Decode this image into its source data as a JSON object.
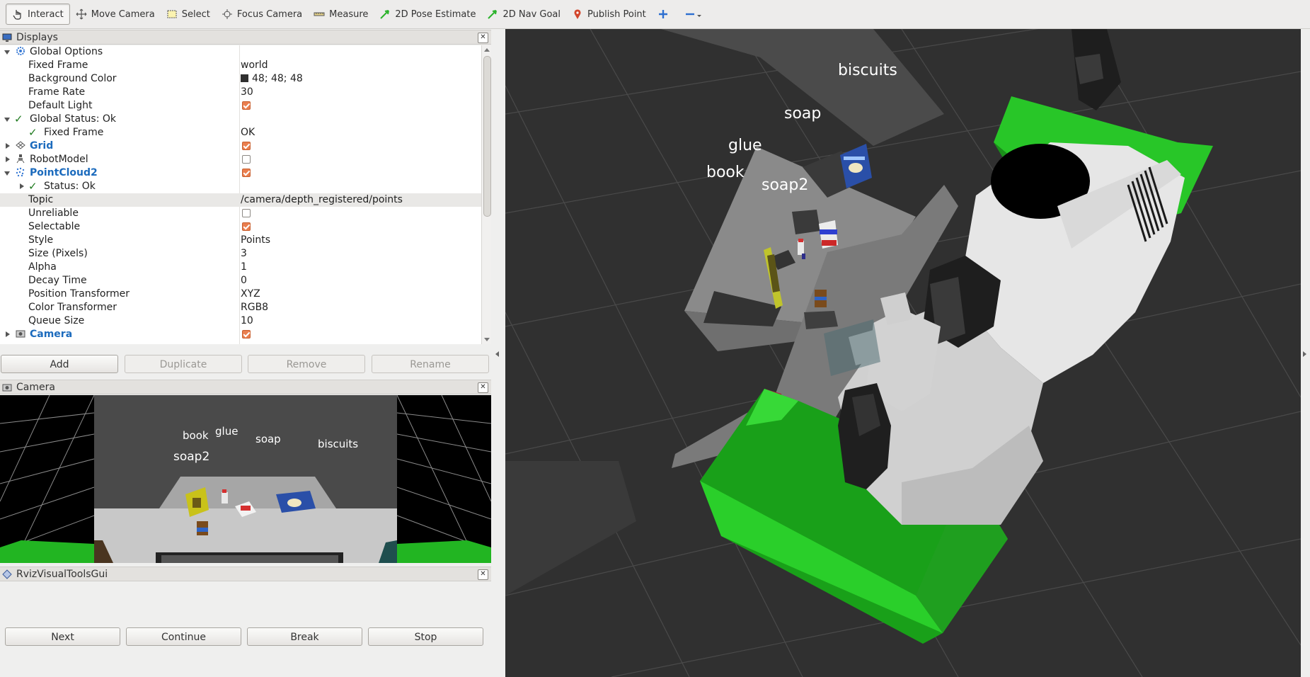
{
  "toolbar": {
    "tools": [
      {
        "label": "Interact",
        "icon": "hand-pointer-icon",
        "active": true
      },
      {
        "label": "Move Camera",
        "icon": "move-camera-icon"
      },
      {
        "label": "Select",
        "icon": "select-box-icon"
      },
      {
        "label": "Focus Camera",
        "icon": "focus-crosshair-icon"
      },
      {
        "label": "Measure",
        "icon": "ruler-icon"
      },
      {
        "label": "2D Pose Estimate",
        "icon": "green-arrow-icon"
      },
      {
        "label": "2D Nav Goal",
        "icon": "green-arrow-icon"
      },
      {
        "label": "Publish Point",
        "icon": "map-pin-icon"
      }
    ],
    "add_tool_icon": "plus-icon",
    "remove_tool_icon": "minus-icon"
  },
  "displays_panel": {
    "title": "Displays",
    "rows": [
      {
        "name": "Global Options"
      },
      {
        "name": "Fixed Frame",
        "value": "world"
      },
      {
        "name": "Background Color",
        "value": "48; 48; 48"
      },
      {
        "name": "Frame Rate",
        "value": "30"
      },
      {
        "name": "Default Light",
        "value": ""
      },
      {
        "name": "Global Status: Ok"
      },
      {
        "name": "Fixed Frame",
        "value": "OK"
      },
      {
        "name": "Grid"
      },
      {
        "name": "RobotModel"
      },
      {
        "name": "PointCloud2"
      },
      {
        "name": "Status: Ok"
      },
      {
        "name": "Topic",
        "value": "/camera/depth_registered/points"
      },
      {
        "name": "Unreliable"
      },
      {
        "name": "Selectable"
      },
      {
        "name": "Style",
        "value": "Points"
      },
      {
        "name": "Size (Pixels)",
        "value": "3"
      },
      {
        "name": "Alpha",
        "value": "1"
      },
      {
        "name": "Decay Time",
        "value": "0"
      },
      {
        "name": "Position Transformer",
        "value": "XYZ"
      },
      {
        "name": "Color Transformer",
        "value": "RGB8"
      },
      {
        "name": "Queue Size",
        "value": "10"
      },
      {
        "name": "Camera"
      }
    ],
    "checkbox_states": {
      "default_light": true,
      "grid": true,
      "robot_model": false,
      "pointcloud2": true,
      "unreliable": false,
      "selectable": true,
      "camera": true
    },
    "background_color_hex": "#303030",
    "buttons": {
      "add": "Add",
      "duplicate": "Duplicate",
      "remove": "Remove",
      "rename": "Rename"
    }
  },
  "camera_panel": {
    "title": "Camera",
    "labels": {
      "book": "book",
      "glue": "glue",
      "soap": "soap",
      "biscuits": "biscuits",
      "soap2": "soap2"
    }
  },
  "rviz_visual_tools_panel": {
    "title": "RvizVisualToolsGui",
    "buttons": {
      "next": "Next",
      "continue": "Continue",
      "break": "Break",
      "stop": "Stop"
    }
  },
  "view3d": {
    "background_hex": "#303030",
    "labels": {
      "biscuits": "biscuits",
      "soap": "soap",
      "glue": "glue",
      "book": "book",
      "soap2": "soap2"
    }
  },
  "colors": {
    "accent_blue": "#1c6bbd",
    "status_green": "#1f7a1f",
    "checkbox_orange": "#ea7f4f",
    "bin_green": "#22c622"
  }
}
